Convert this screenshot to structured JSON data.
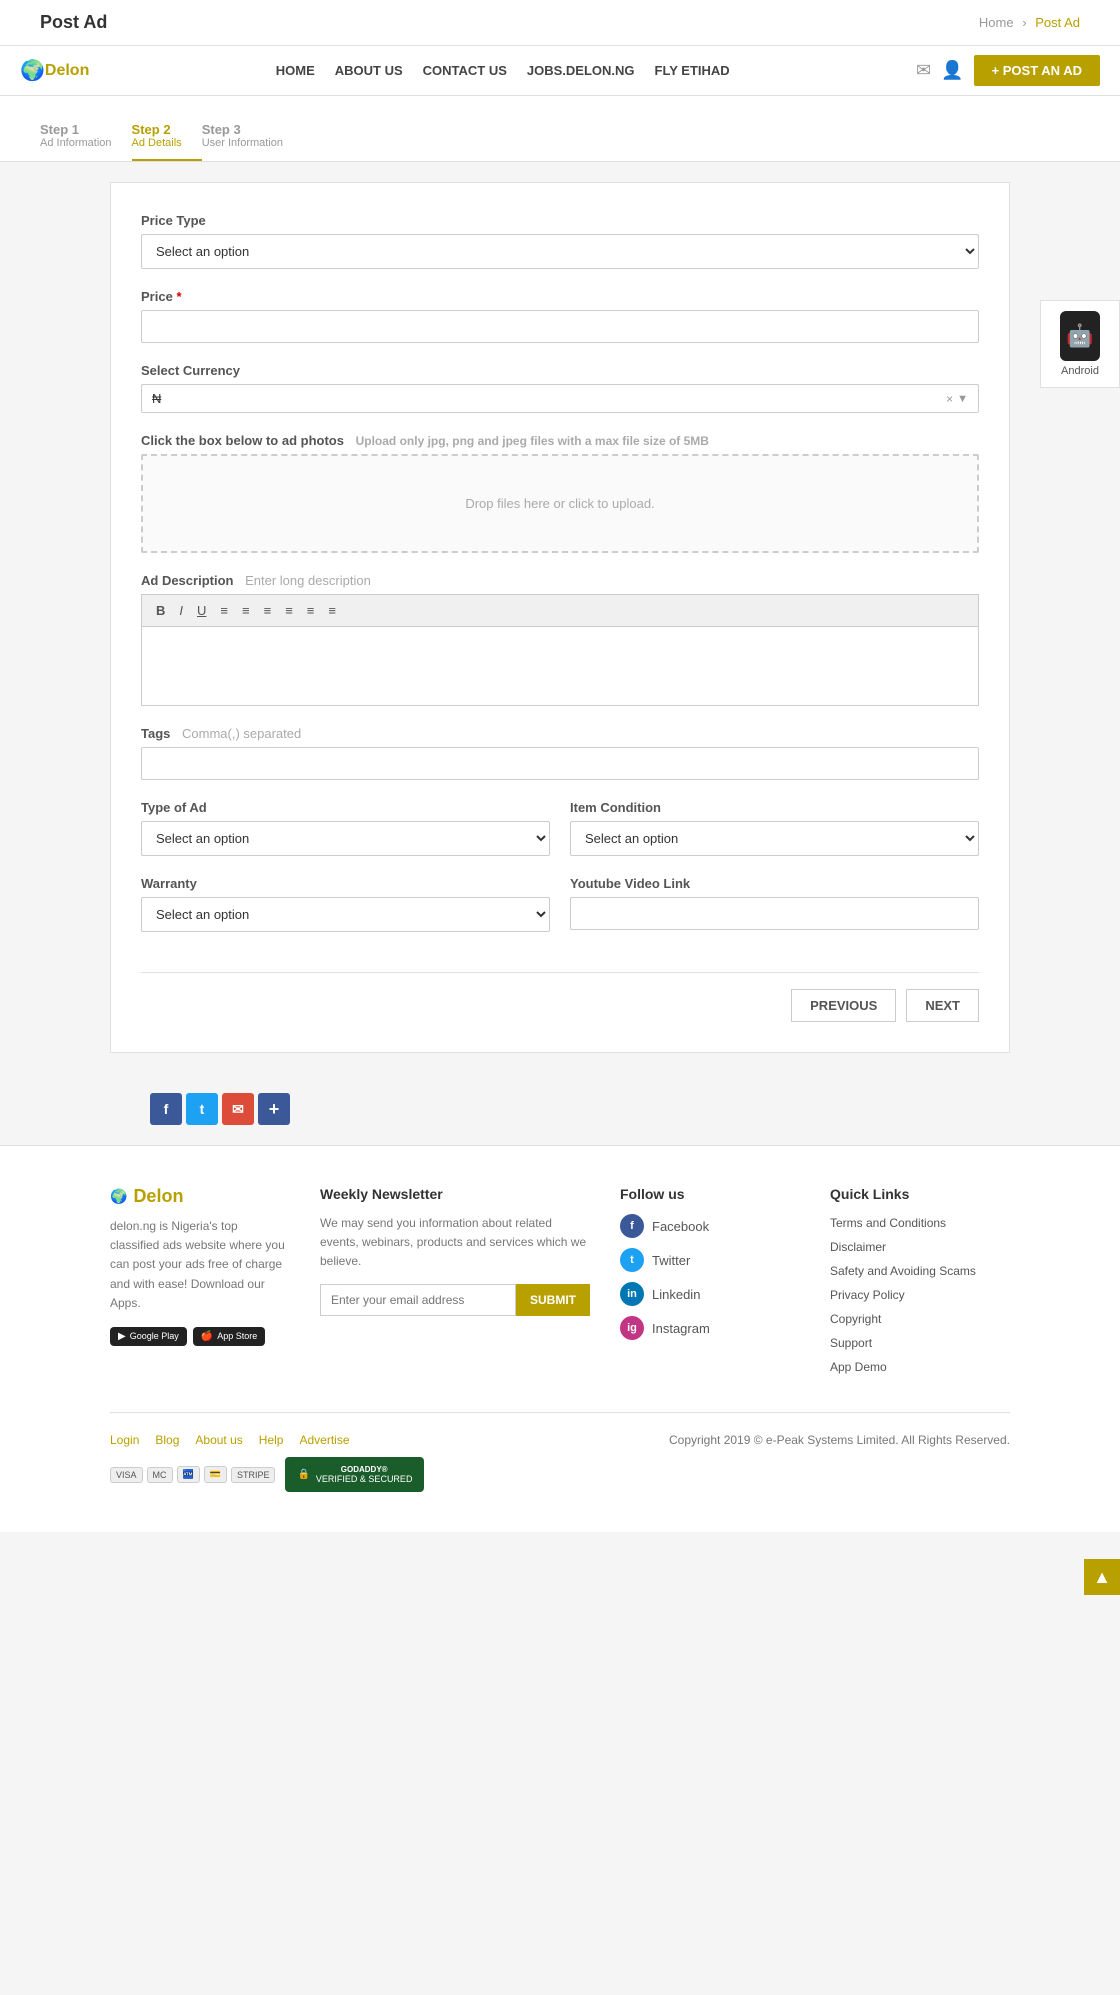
{
  "header": {
    "title": "Post Ad",
    "breadcrumb": {
      "home": "Home",
      "current": "Post Ad"
    }
  },
  "navbar": {
    "logo": "Delon",
    "links": [
      "HOME",
      "ABOUT US",
      "CONTACT US",
      "JOBS.DELON.NG",
      "FLY ETIHAD"
    ],
    "post_ad_label": "+ POST AN AD"
  },
  "steps": [
    {
      "num": "Step 1",
      "label": "Ad Information",
      "state": "done"
    },
    {
      "num": "Step 2",
      "label": "Ad Details",
      "state": "active"
    },
    {
      "num": "Step 3",
      "label": "User Information",
      "state": "pending"
    }
  ],
  "form": {
    "price_type": {
      "label": "Price Type",
      "placeholder": "Select an option"
    },
    "price": {
      "label": "Price",
      "required": true
    },
    "currency": {
      "label": "Select Currency",
      "value": "₦"
    },
    "photos": {
      "label": "Click the box below to ad photos",
      "hint": "Upload only jpg, png and jpeg files with a max file size of 5MB",
      "drop_text": "Drop files here or click to upload."
    },
    "description": {
      "label": "Ad Description",
      "placeholder": "Enter long description",
      "toolbar": [
        "B",
        "I",
        "U",
        "≡",
        "≡",
        "≡",
        "≡",
        "≡",
        "≡"
      ]
    },
    "tags": {
      "label": "Tags",
      "placeholder": "Comma(,) separated"
    },
    "type_of_ad": {
      "label": "Type of Ad",
      "placeholder": "Select an option"
    },
    "item_condition": {
      "label": "Item Condition",
      "placeholder": "Select an option"
    },
    "warranty": {
      "label": "Warranty",
      "placeholder": "Select an option"
    },
    "youtube_link": {
      "label": "Youtube Video Link"
    },
    "buttons": {
      "previous": "PREVIOUS",
      "next": "NEXT"
    }
  },
  "social_share": {
    "buttons": [
      {
        "label": "f",
        "name": "facebook",
        "color": "#3b5998"
      },
      {
        "label": "t",
        "name": "twitter",
        "color": "#1da1f2"
      },
      {
        "label": "✉",
        "name": "email",
        "color": "#dd4b39"
      },
      {
        "label": "+",
        "name": "share",
        "color": "#3b5998"
      }
    ]
  },
  "footer": {
    "logo": "Delon",
    "description": "delon.ng is Nigeria's top classified ads website where you can post your ads free of charge and with ease! Download our Apps.",
    "apps": [
      {
        "store": "Google Play",
        "icon": "▶"
      },
      {
        "store": "App Store",
        "icon": ""
      }
    ],
    "newsletter": {
      "heading": "Weekly Newsletter",
      "text": "We may send you information about related events, webinars, products and services which we believe.",
      "placeholder": "Enter your email address",
      "submit": "SUBMIT"
    },
    "follow": {
      "heading": "Follow us",
      "items": [
        {
          "label": "Facebook",
          "icon": "f",
          "class": "fi-fb"
        },
        {
          "label": "Twitter",
          "icon": "t",
          "class": "fi-tw"
        },
        {
          "label": "Linkedin",
          "icon": "in",
          "class": "fi-li"
        },
        {
          "label": "Instagram",
          "icon": "ig",
          "class": "fi-ig"
        }
      ]
    },
    "quick_links": {
      "heading": "Quick Links",
      "items": [
        "Terms and Conditions",
        "Disclaimer",
        "Safety and Avoiding Scams",
        "Privacy Policy",
        "Copyright",
        "Support",
        "App Demo"
      ]
    },
    "bottom_links": [
      "Login",
      "Blog",
      "About us",
      "Help",
      "Advertise"
    ],
    "copyright": "Copyright 2019 © e-Peak Systems Limited.  All Rights Reserved.",
    "payment_icons": [
      "VISA",
      "MC",
      "⬛",
      "💳",
      "STRIPE"
    ],
    "security": "VERIFIED & SECURED"
  },
  "android_sidebar": {
    "label": "Android"
  }
}
